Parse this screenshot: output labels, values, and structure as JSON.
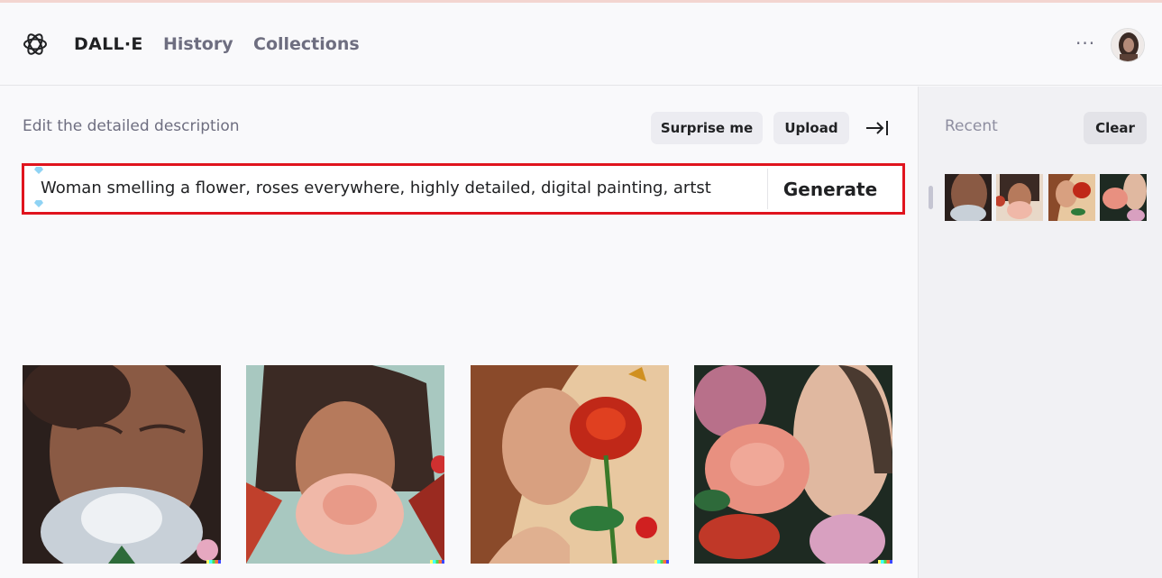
{
  "header": {
    "brand": "DALL·E",
    "nav": [
      "History",
      "Collections"
    ],
    "more_label": "···"
  },
  "editor": {
    "instruction": "Edit the detailed description",
    "surprise_label": "Surprise me",
    "upload_label": "Upload",
    "prompt_value": "Woman smelling a flower, roses everywhere, highly detailed, digital painting, artst",
    "generate_label": "Generate"
  },
  "sidebar": {
    "recent_label": "Recent",
    "clear_label": "Clear"
  },
  "colors": {
    "highlight_border": "#e0141e",
    "button_bg": "#ececf1"
  },
  "icons": [
    "openai-logo-icon",
    "more-icon",
    "collapse-sidebar-icon",
    "gem-icon"
  ]
}
